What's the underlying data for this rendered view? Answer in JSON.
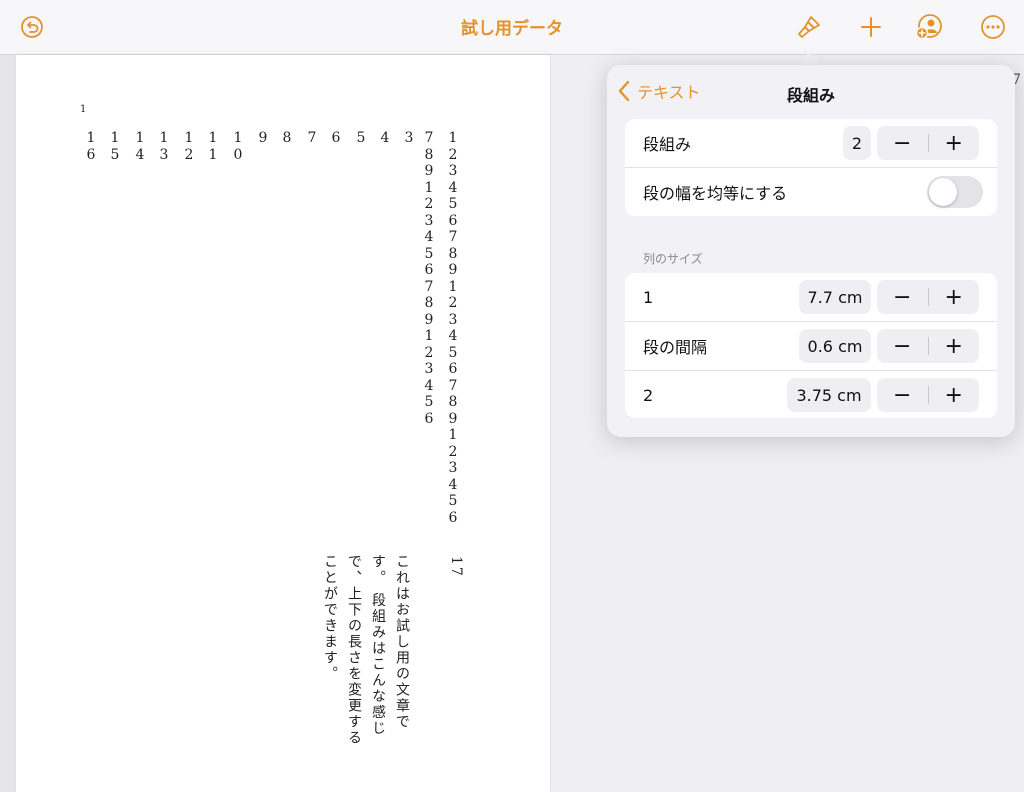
{
  "document": {
    "title": "試し用データ",
    "page_number": "1",
    "columns": [
      "1\n6",
      "1\n5",
      "1\n4",
      "1\n3",
      "1\n2",
      "1\n1",
      "1\n0",
      "9",
      "8",
      "7",
      "6",
      "5",
      "4",
      "3",
      "7\n8\n9\n1\n2\n3\n4\n5\n6\n7\n8\n9\n1\n2\n3\n4\n5\n6",
      "1\n2\n3\n4\n5\n6\n7\n8\n9\n1\n2\n3\n4\n5\n6\n7\n8\n9\n1\n2\n3\n4\n5\n6"
    ],
    "paragraph_number": "17",
    "body_text": "これはお試し用の文章です。\n段組みはこんな感じで、上下の長さを変更することができます。",
    "edge_fragment": "7"
  },
  "toolbar": {
    "undo": "undo-icon",
    "format": "paintbrush-icon",
    "insert": "plus-icon",
    "collaborate": "add-person-icon",
    "more": "more-icon"
  },
  "popover": {
    "back_label": "テキスト",
    "title": "段組み",
    "columns_row": {
      "label": "段組み",
      "value": "2"
    },
    "equal_width_row": {
      "label": "段の幅を均等にする",
      "enabled": false
    },
    "section_label": "列のサイズ",
    "size_rows": [
      {
        "label": "1",
        "value": "7.7 cm"
      },
      {
        "label": "段の間隔",
        "value": "0.6 cm"
      },
      {
        "label": "2",
        "value": "3.75 cm"
      }
    ],
    "minus": "−",
    "plus": "+"
  },
  "colors": {
    "accent": "#e3922c",
    "popover_bg": "#f2f2f6"
  }
}
